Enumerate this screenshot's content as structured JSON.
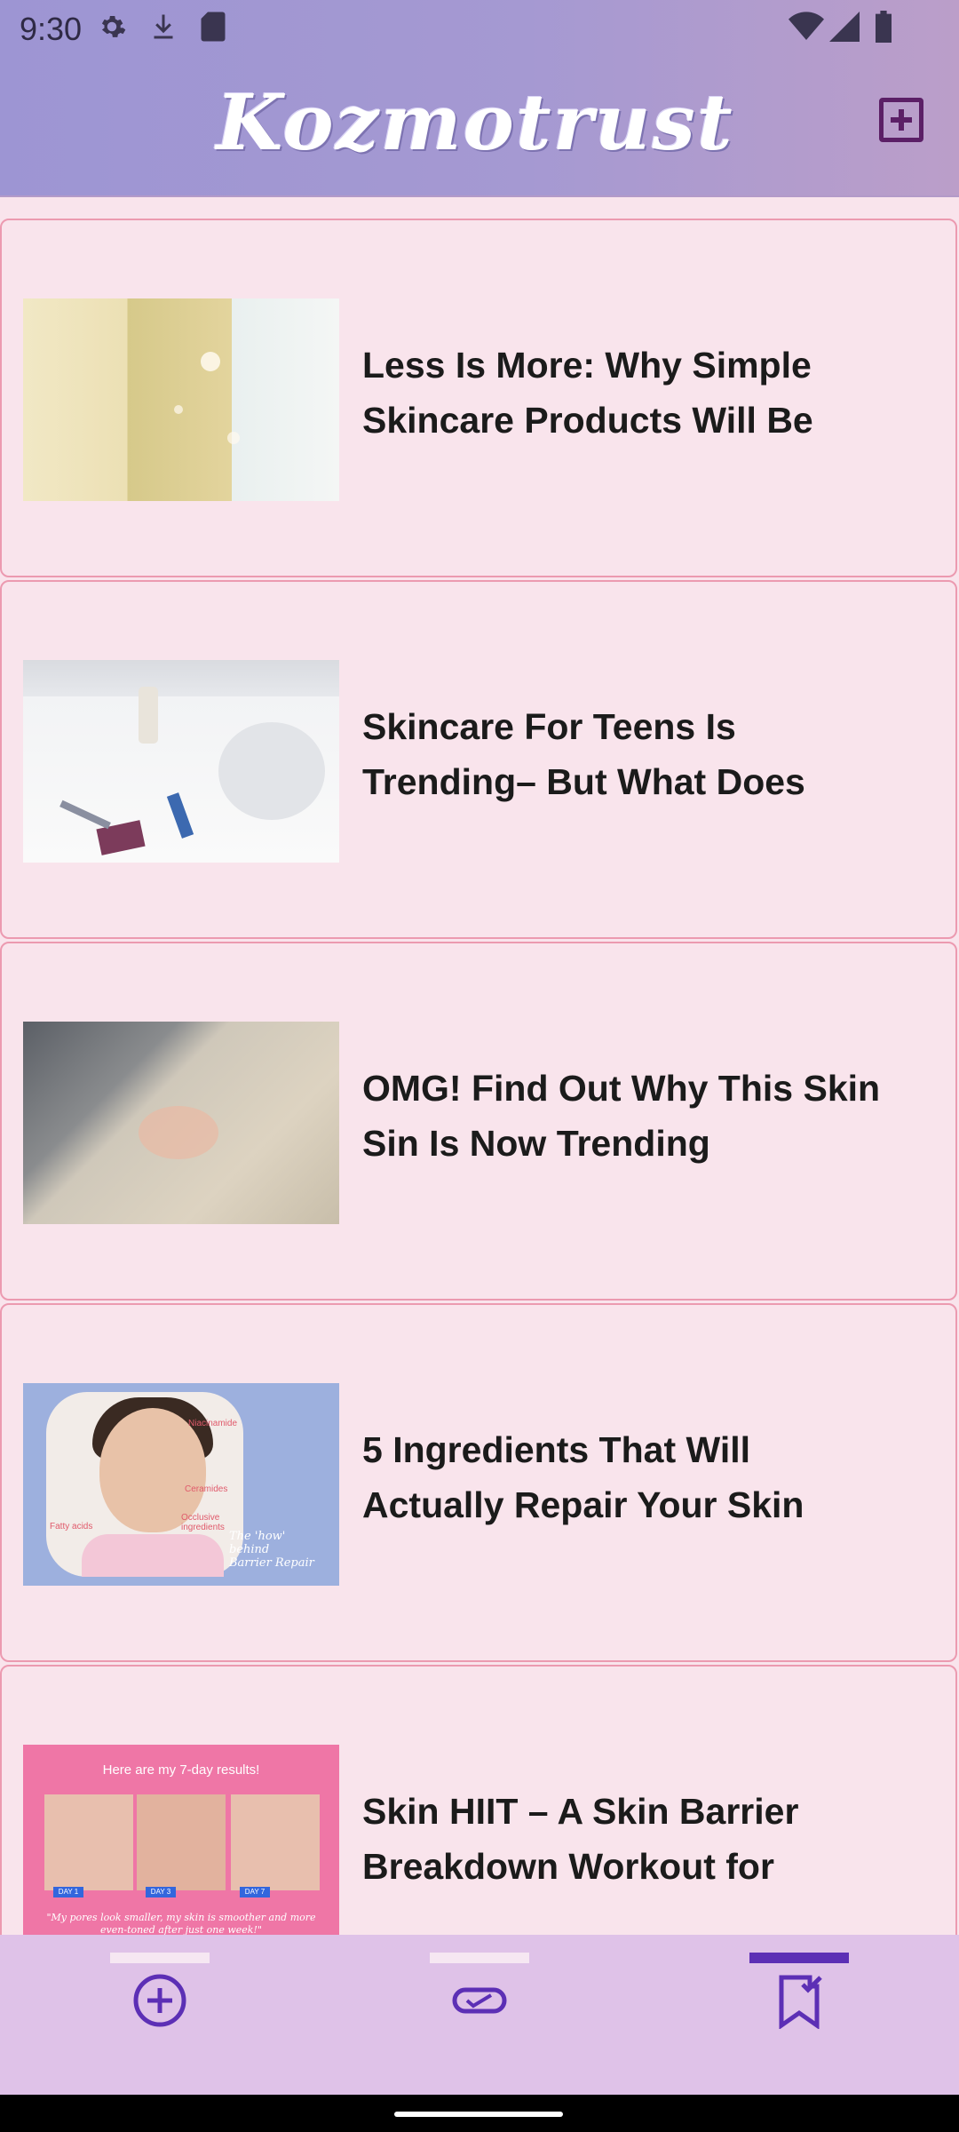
{
  "status_bar": {
    "time": "9:30"
  },
  "header": {
    "brand": "Kozmotrust",
    "add_icon": "add-box-icon"
  },
  "articles": [
    {
      "title": "Less Is More: Why Simple Skincare Products Will Be"
    },
    {
      "title": "Skincare For Teens Is Trending– But What Does"
    },
    {
      "title": "OMG! Find Out Why This Skin Sin Is Now Trending"
    },
    {
      "title": "5 Ingredients That Will Actually Repair Your Skin",
      "image_text": {
        "caption_1": "The 'how' behind",
        "caption_2": "Barrier Repair",
        "label_a": "Niacinamide",
        "label_b": "Ceramides",
        "label_c": "Occlusive ingredients",
        "label_d": "Fatty acids"
      }
    },
    {
      "title": "Skin HIIT – A Skin Barrier Breakdown Workout for",
      "image_text": {
        "heading": "Here are my 7-day results!",
        "tag_1": "DAY 1",
        "tag_2": "DAY 3",
        "tag_3": "DAY 7",
        "quote": "\"My pores look smaller, my skin is smoother and more even-toned after just one week!\""
      }
    }
  ],
  "bottom_nav": [
    {
      "icon": "add-circle-icon",
      "active": false
    },
    {
      "icon": "ticket-check-icon",
      "active": false
    },
    {
      "icon": "bookmark-check-icon",
      "active": true
    }
  ],
  "colors": {
    "accent": "#5c2fb5",
    "header": "#a599d2",
    "card_bg": "#f9e4ec",
    "card_border": "#ec9ab0",
    "nav_bg": "#dfc2e8"
  }
}
